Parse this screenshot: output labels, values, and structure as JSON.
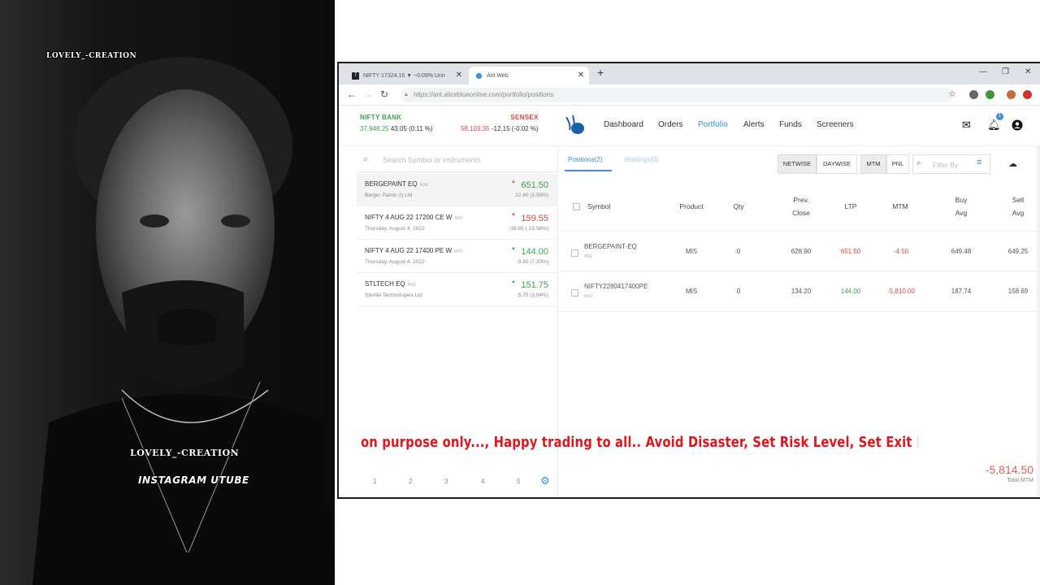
{
  "watermark": {
    "top": "LOVELY_-CREATION",
    "middle": "LOVELY_-CREATION",
    "sub": "INSTAGRAM UTUBE"
  },
  "browser": {
    "tabs": [
      {
        "label": "NIFTY 17324.15 ▼ −0.09% Unn",
        "icon": "chart-favicon"
      },
      {
        "label": "Ant Web",
        "icon": "ant-favicon"
      }
    ],
    "url": "https://ant.aliceblueonline.com/portfolio/positions",
    "window_controls": [
      "—",
      "❐",
      "✕"
    ]
  },
  "header": {
    "indices": [
      {
        "name": "NIFTY BANK",
        "value": "37,948.25",
        "change": "43.05 (0.11 %)",
        "color": "#3aa34a"
      },
      {
        "name": "SENSEX",
        "value": "58,103.35",
        "change": "-12.15 (-0.02 %)",
        "color": "#e04545"
      }
    ],
    "menu": [
      "Dashboard",
      "Orders",
      "Portfolio",
      "Alerts",
      "Funds",
      "Screeners"
    ],
    "active_menu": "Portfolio",
    "notification_count": "1"
  },
  "watchlist": {
    "search_placeholder": "Search Symbol or instruments",
    "items": [
      {
        "symbol": "BERGEPAINT EQ",
        "exchange": "NSE",
        "sub": "Berger Paints (I) Ltd",
        "price": "651.50",
        "change": "22.60 (3.59%)",
        "direction": "up"
      },
      {
        "symbol": "NIFTY 4 AUG 22 17200 CE W",
        "exchange": "NFO",
        "sub": "Thursday, August 4, 2022",
        "price": "159.55",
        "change": "-38.85 (-19.58%)",
        "direction": "down"
      },
      {
        "symbol": "NIFTY 4 AUG 22 17400 PE W",
        "exchange": "NFO",
        "sub": "Thursday, August 4, 2022",
        "price": "144.00",
        "change": "9.80 (7.30%)",
        "direction": "up"
      },
      {
        "symbol": "STLTECH EQ",
        "exchange": "NSE",
        "sub": "Sterlite Technologies Ltd",
        "price": "151.75",
        "change": "5.75 (3.94%)",
        "direction": "up"
      }
    ],
    "pages": [
      "1",
      "2",
      "3",
      "4",
      "5"
    ]
  },
  "positions": {
    "tabs": [
      "Positions(2)",
      "Holdings(0)"
    ],
    "view_buttons": [
      "NETWISE",
      "DAYWISE",
      "MTM",
      "PNL"
    ],
    "filter_placeholder": "Filter By",
    "columns": [
      "Symbol",
      "Product",
      "Qty",
      "Prev.\nClose",
      "LTP",
      "MTM",
      "Buy\nAvg",
      "Sell\nAvg"
    ],
    "rows": [
      {
        "symbol": "BERGEPAINT-EQ",
        "exchange": "NSE",
        "product": "MIS",
        "qty": "0",
        "prev_close": "628.90",
        "ltp": "651.50",
        "mtm": "-4.50",
        "buy_avg": "649.48",
        "sell_avg": "649.25",
        "ltp_color": "#e04545"
      },
      {
        "symbol": "NIFTY2280417400PE",
        "exchange": "NFO",
        "product": "MIS",
        "qty": "0",
        "prev_close": "134.20",
        "ltp": "144.00",
        "mtm": "-5,810.00",
        "buy_avg": "187.74",
        "sell_avg": "158.69",
        "ltp_color": "#3aa34a"
      }
    ],
    "total_mtm_value": "-5,814.50",
    "total_mtm_label": "Total MTM"
  },
  "ticker_text": "on purpose only..., Happy trading to all.. Avoid Disaster, Set Risk Level, Set Exit Rules, Set Entry sales"
}
